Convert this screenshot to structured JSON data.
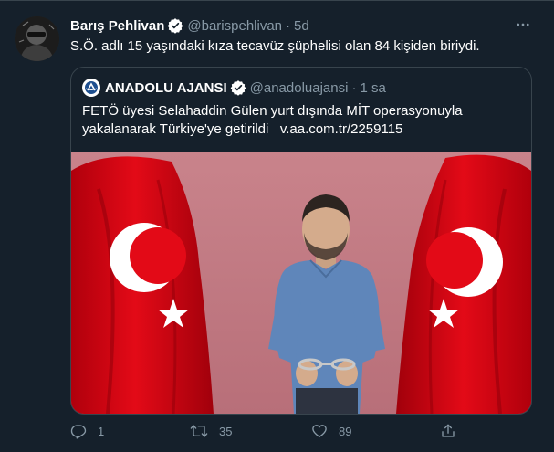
{
  "tweet": {
    "author_name": "Barış Pehlivan",
    "author_handle": "@barispehlivan",
    "separator": "·",
    "time": "5d",
    "text": "S.Ö. adlı 15 yaşındaki kıza tecavüz şüphelisi olan 84 kişiden biriydi.",
    "more_label": "···"
  },
  "quote": {
    "author_name": "ANADOLU AJANSI",
    "author_handle": "@anadoluajansi",
    "separator": "·",
    "time": "1 sa",
    "text_line1": "FETÖ üyesi Selahaddin Gülen yurt dışında MİT operasyonuyla",
    "text_line2": "yakalanarak Türkiye'ye getirildi",
    "link": "v.aa.com.tr/2259115"
  },
  "actions": {
    "reply_count": "1",
    "retweet_count": "35",
    "like_count": "89"
  },
  "colors": {
    "background": "#15202b",
    "border": "#38444d",
    "secondary_text": "#8899a6",
    "verified": "#1da1f2",
    "flag_red": "#e30a17",
    "wall_pink": "#c27a83"
  }
}
